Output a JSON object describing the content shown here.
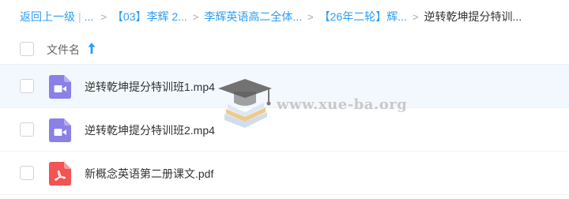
{
  "breadcrumb": {
    "back_label": "返回上一级",
    "pipe": "|",
    "ellipsis": "...",
    "separator": ">",
    "items": [
      "【03】李辉 2...",
      "李辉英语高二全体...",
      "【26年二轮】辉...",
      "逆转乾坤提分特训..."
    ]
  },
  "list_header": {
    "column_name": "文件名",
    "sort": "ascending"
  },
  "files": [
    {
      "name": "逆转乾坤提分特训班1.mp4",
      "type": "video",
      "icon": "video-file-icon",
      "hovered": true
    },
    {
      "name": "逆转乾坤提分特训班2.mp4",
      "type": "video",
      "icon": "video-file-icon",
      "hovered": false
    },
    {
      "name": "新概念英语第二册课文.pdf",
      "type": "pdf",
      "icon": "pdf-file-icon",
      "hovered": false
    }
  ],
  "watermark": {
    "text": "www.xue-ba.org"
  },
  "colors": {
    "link": "#2b9df7",
    "video_icon": "#8b7fe8",
    "pdf_icon": "#f05454",
    "hover_row": "#f3f8fe"
  }
}
